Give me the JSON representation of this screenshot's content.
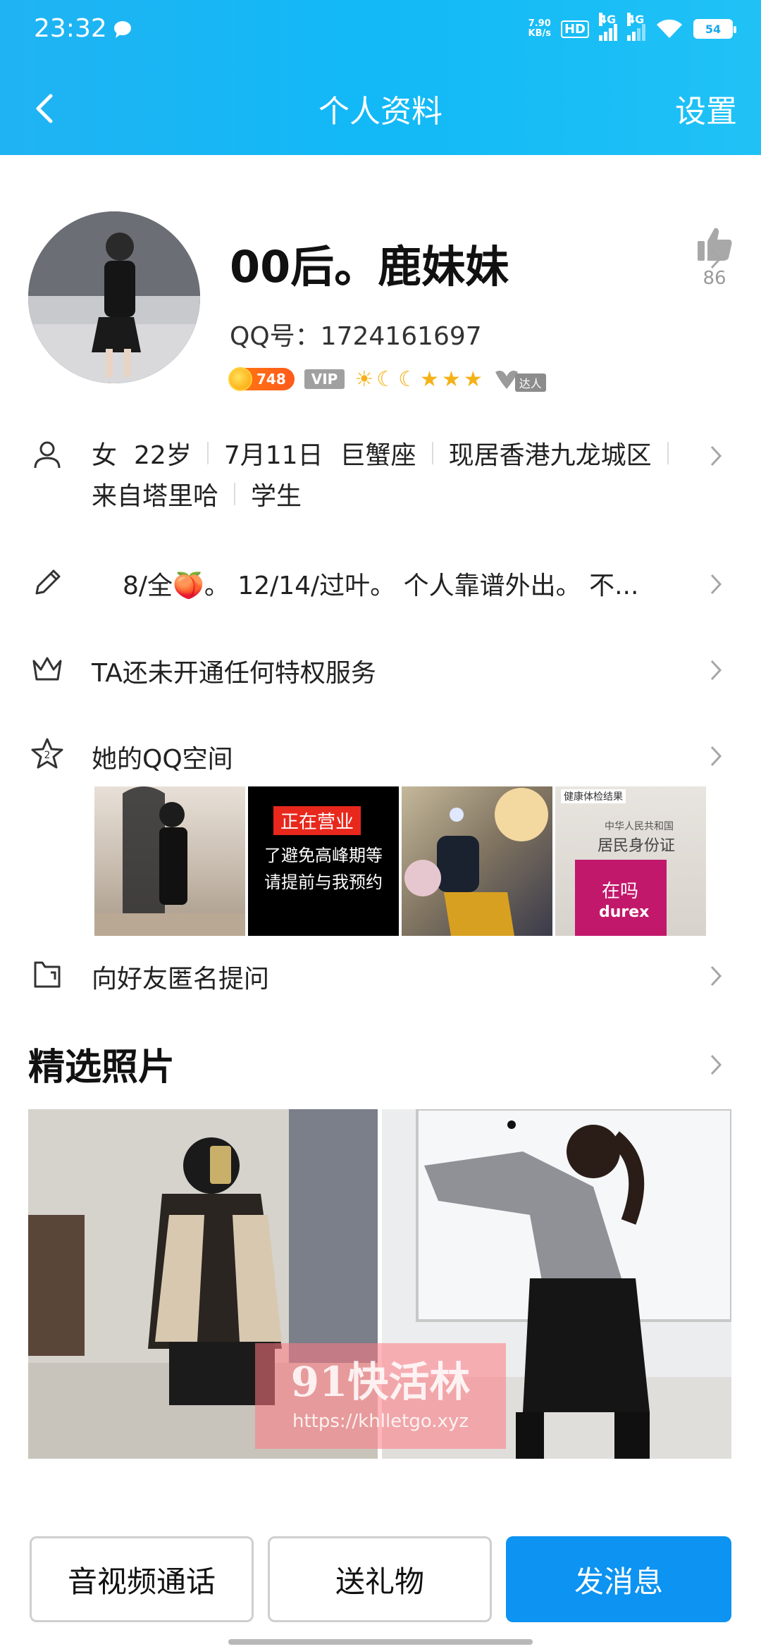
{
  "status_bar": {
    "time": "23:32",
    "net_speed_value": "7.90",
    "net_speed_unit": "KB/s",
    "hd_label": "HD",
    "signal1_label": "4G",
    "signal2_label": "4G",
    "battery": "54"
  },
  "navbar": {
    "title": "个人资料",
    "settings_label": "设置"
  },
  "profile": {
    "nickname": "00后。鹿妹妹",
    "qq_label": "QQ号：1724161697",
    "level_number": "748",
    "vip_label": "VIP",
    "daren_label": "达人",
    "like_count": "86"
  },
  "info_row": {
    "line1": [
      "女",
      "22岁",
      "7月11日",
      "巨蟹座",
      "现居香港九龙城区"
    ],
    "line2": [
      "来自塔里哈",
      "学生"
    ]
  },
  "signature_row": {
    "text": "8/全🍑。 12/14/过叶。 个人靠谱外出。 不..."
  },
  "privilege_row": {
    "text": "TA还未开通任何特权服务"
  },
  "qzone_row": {
    "text": "她的QQ空间",
    "photos": [
      {
        "overlay": ""
      },
      {
        "overlay_title": "正在营业",
        "overlay_line1": "了避免高峰期等",
        "overlay_line2": "请提前与我预约"
      },
      {
        "overlay": ""
      },
      {
        "overlay_top": "健康体检结果",
        "overlay_id1": "中华人民共和国",
        "overlay_id2": "居民身份证",
        "overlay_brand": "durex",
        "overlay_text": "在吗"
      }
    ]
  },
  "question_row": {
    "text": "向好友匿名提问"
  },
  "featured": {
    "title": "精选照片",
    "watermark_main": "91快活林",
    "watermark_url": "https://khlletgo.xyz"
  },
  "bottom_bar": {
    "call_label": "音视频通话",
    "gift_label": "送礼物",
    "message_label": "发消息"
  },
  "colors": {
    "header_blue": "#12b9f6",
    "primary_button": "#0d93f1"
  }
}
